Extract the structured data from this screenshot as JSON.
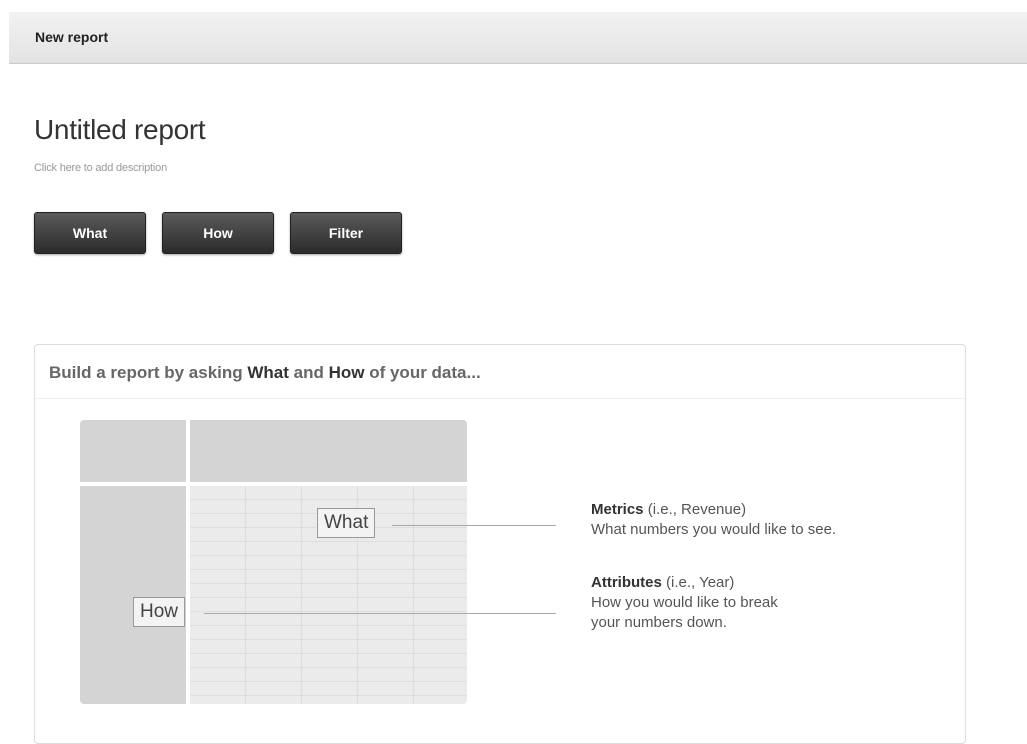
{
  "topbar": {
    "title": "New report"
  },
  "report": {
    "title": "Untitled report",
    "description_placeholder": "Click here to add description"
  },
  "actions": {
    "what_label": "What",
    "how_label": "How",
    "filter_label": "Filter"
  },
  "panel": {
    "header_prefix": "Build a report by asking ",
    "header_what": "What",
    "header_and": " and ",
    "header_how": "How",
    "header_suffix": " of your data..."
  },
  "diagram": {
    "what_tag": "What",
    "how_tag": "How",
    "metrics_title": "Metrics",
    "metrics_example": " (i.e., Revenue)",
    "metrics_desc": "What numbers you would like to see.",
    "attributes_title": "Attributes",
    "attributes_example": " (i.e., Year)",
    "attributes_desc_1": "How you would like to break",
    "attributes_desc_2": "your numbers down."
  }
}
